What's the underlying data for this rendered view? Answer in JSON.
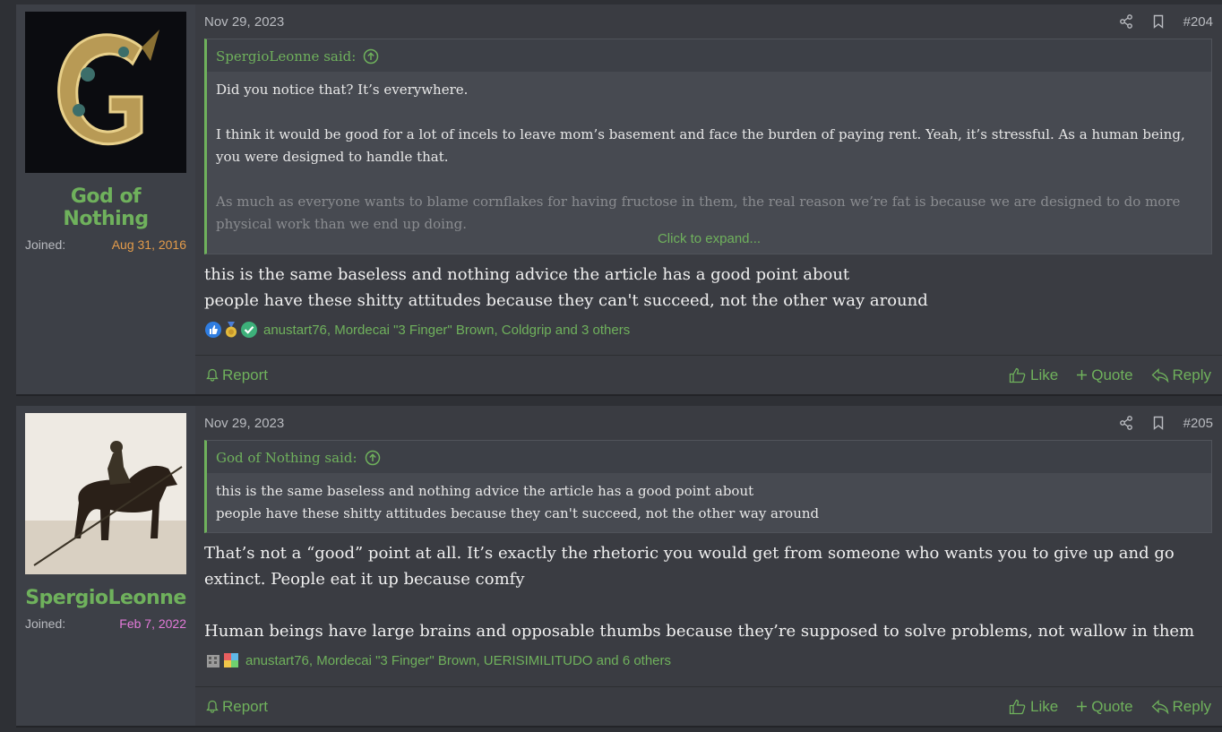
{
  "posts": [
    {
      "author": "God of Nothing",
      "joined_label": "Joined:",
      "joined_date": "Aug 31, 2016",
      "joined_color": "#e39b4a",
      "date": "Nov 29, 2023",
      "number": "#204",
      "quote_author": "SpergioLeonne said:",
      "quote_paragraphs": [
        "Did you notice that? It’s everywhere.",
        "I think it would be good for a lot of incels to leave mom’s basement and face the burden of paying rent. Yeah, it’s stressful. As a human being, you were designed to handle that.",
        "As much as everyone wants to blame cornflakes for having fructose in them, the real reason we’re fat is because we are designed to do more physical work than we end up doing."
      ],
      "expand_label": "Click to expand...",
      "body": [
        "this is the same baseless and nothing advice the article has a good point about",
        "people have these shitty attitudes because they can't succeed, not the other way around"
      ],
      "reactions_text": "anustart76, Mordecai \"3 Finger\" Brown, Coldgrip and 3 others"
    },
    {
      "author": "SpergioLeonne",
      "joined_label": "Joined:",
      "joined_date": "Feb 7, 2022",
      "joined_color": "#e37ad9",
      "date": "Nov 29, 2023",
      "number": "#205",
      "quote_author": "God of Nothing said:",
      "quote_paragraphs": [
        "this is the same baseless and nothing advice the article has a good point about",
        "people have these shitty attitudes because they can't succeed, not the other way around"
      ],
      "body": [
        "That’s not a “good” point at all. It’s exactly the rhetoric you would get from someone who wants you to give up and go extinct. People eat it up because comfy",
        "Human beings have large brains and opposable thumbs because they’re supposed to solve problems, not wallow in them"
      ],
      "reactions_text": "anustart76, Mordecai \"3 Finger\" Brown, UERISIMILITUDO and 6 others"
    }
  ],
  "actions": {
    "report": "Report",
    "like": "Like",
    "quote": "Quote",
    "reply": "Reply"
  },
  "colors": {
    "accent": "#6fb15c",
    "background": "#2e3035",
    "post_bg": "#3a3c42"
  },
  "icons": [
    "share-icon",
    "bookmark-icon",
    "arrow-up-circle-icon",
    "bell-icon",
    "thumbs-up-icon",
    "plus-icon",
    "reply-arrow-icon"
  ]
}
